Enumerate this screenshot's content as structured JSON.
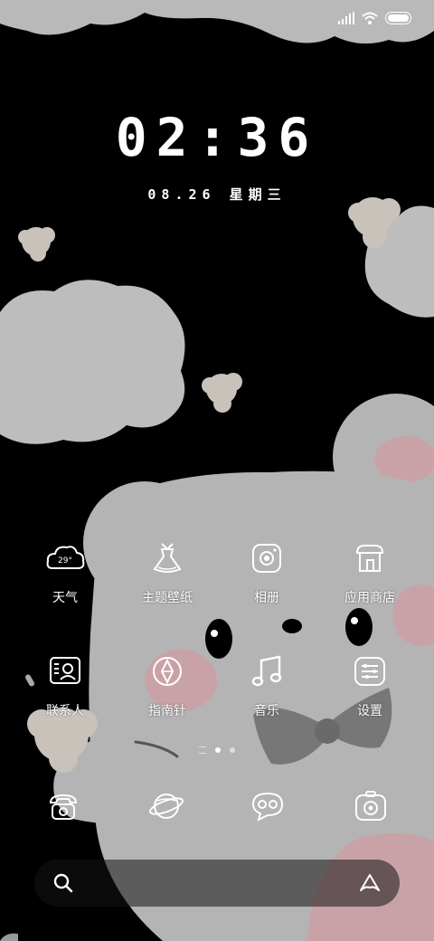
{
  "lockscreen": {
    "time": "02:36",
    "date": "08.26 星期三"
  },
  "apps": [
    {
      "label": "天气",
      "icon": "weather-cloud-icon",
      "badge": "29°"
    },
    {
      "label": "主题壁纸",
      "icon": "dress-icon"
    },
    {
      "label": "相册",
      "icon": "camera-icon"
    },
    {
      "label": "应用商店",
      "icon": "shop-icon"
    },
    {
      "label": "联系人",
      "icon": "contacts-card-icon"
    },
    {
      "label": "指南针",
      "icon": "compass-icon"
    },
    {
      "label": "音乐",
      "icon": "music-note-icon"
    },
    {
      "label": "设置",
      "icon": "settings-panel-icon"
    }
  ],
  "dock": [
    {
      "icon": "phone-icon"
    },
    {
      "icon": "browser-planet-icon"
    },
    {
      "icon": "messages-icon"
    },
    {
      "icon": "camera-icon"
    }
  ],
  "page_indicator": {
    "pages": 3,
    "current": 2
  },
  "search": {
    "icon": "search-icon",
    "assistant_icon": "assistant-icon"
  },
  "colors": {
    "background": "#000000",
    "bear_gray": "#b5b5b5",
    "cheek_pink": "#c9a2a7",
    "cloud_gray": "#bdbdbd"
  }
}
